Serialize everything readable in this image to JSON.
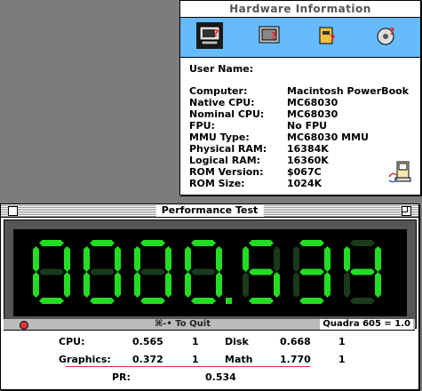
{
  "hardware": {
    "title": "Hardware Information",
    "toolbar_icons": [
      "computer-info-icon",
      "monitor-info-icon",
      "card-info-icon",
      "disk-info-icon"
    ],
    "user_name_label": "User Name:",
    "rows": [
      {
        "k": "Computer:",
        "v": "Macintosh PowerBook"
      },
      {
        "k": "Native CPU:",
        "v": "MC68030"
      },
      {
        "k": "Nominal CPU:",
        "v": "MC68030"
      },
      {
        "k": "FPU:",
        "v": "No FPU"
      },
      {
        "k": "MMU Type:",
        "v": "MC68030 MMU"
      },
      {
        "k": "Physical RAM:",
        "v": "16384K"
      },
      {
        "k": "Logical RAM:",
        "v": "16360K"
      },
      {
        "k": "ROM Version:",
        "v": "$067C"
      },
      {
        "k": "ROM Size:",
        "v": "1024K"
      }
    ]
  },
  "performance": {
    "title": "Performance Test",
    "display_value": "0000.534",
    "led_color": "#22dd22",
    "quit_hint": "⌘-• To Quit",
    "reference": "Quadra 605 = 1.0",
    "results": {
      "cpu_label": "CPU:",
      "cpu_value": "0.565",
      "cpu_count": "1",
      "disk_label": "Disk",
      "disk_value": "0.668",
      "disk_count": "1",
      "graphics_label": "Graphics:",
      "graphics_value": "0.372",
      "graphics_count": "1",
      "math_label": "Math",
      "math_value": "1.770",
      "math_count": "1",
      "pr_label": "PR:",
      "pr_value": "0.534"
    }
  }
}
